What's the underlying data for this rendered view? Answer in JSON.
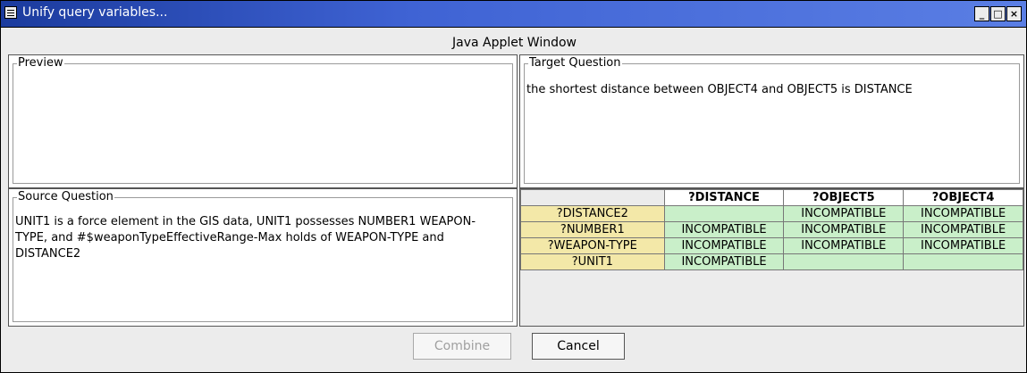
{
  "window": {
    "title": "Unify query variables..."
  },
  "applet_banner": "Java Applet Window",
  "preview": {
    "label": "Preview"
  },
  "target": {
    "label": "Target Question",
    "text": "the shortest distance between OBJECT4 and OBJECT5 is DISTANCE"
  },
  "source": {
    "label": "Source Question",
    "text": "UNIT1 is a force element in the GIS data, UNIT1 possesses NUMBER1 WEAPON-TYPE, and #$weaponTypeEffectiveRange-Max holds of WEAPON-TYPE and DISTANCE2"
  },
  "grid": {
    "columns": [
      "?DISTANCE",
      "?OBJECT5",
      "?OBJECT4"
    ],
    "rows": [
      {
        "name": "?DISTANCE2",
        "cells": [
          "",
          "INCOMPATIBLE",
          "INCOMPATIBLE"
        ]
      },
      {
        "name": "?NUMBER1",
        "cells": [
          "INCOMPATIBLE",
          "INCOMPATIBLE",
          "INCOMPATIBLE"
        ]
      },
      {
        "name": "?WEAPON-TYPE",
        "cells": [
          "INCOMPATIBLE",
          "INCOMPATIBLE",
          "INCOMPATIBLE"
        ]
      },
      {
        "name": "?UNIT1",
        "cells": [
          "INCOMPATIBLE",
          "",
          ""
        ]
      }
    ],
    "colors": {
      "row_header": "#f3e8a8",
      "cell": "#c9efc9"
    }
  },
  "buttons": {
    "combine": "Combine",
    "cancel": "Cancel"
  }
}
